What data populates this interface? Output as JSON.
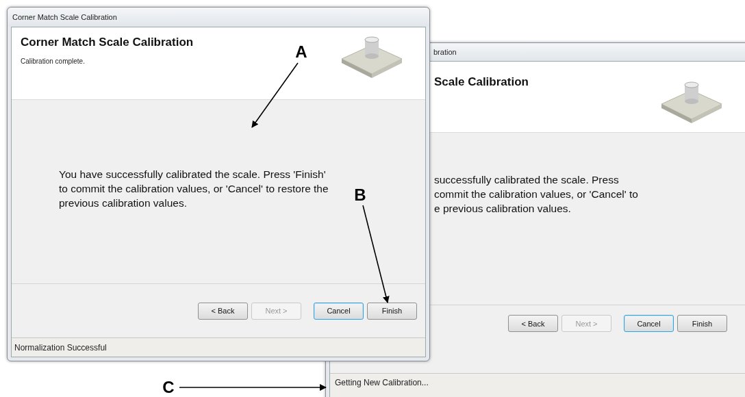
{
  "windows": [
    {
      "title": "Corner Match Scale Calibration",
      "heading": "Corner Match Scale Calibration",
      "subtitle": "Calibration complete.",
      "message": "You have successfully calibrated the scale. Press 'Finish' to commit the calibration values, or 'Cancel' to restore the previous calibration values.",
      "buttons": [
        {
          "label": "< Back",
          "disabled": false,
          "focused": false
        },
        {
          "label": "Next >",
          "disabled": true,
          "focused": false
        },
        {
          "label": "Cancel",
          "disabled": false,
          "focused": true
        },
        {
          "label": "Finish",
          "disabled": false,
          "focused": false
        }
      ],
      "status": "Normalization Successful"
    },
    {
      "title": "bration",
      "heading": "Scale Calibration",
      "message_lines": [
        "successfully calibrated the scale. Press",
        "commit the calibration values, or 'Cancel' to",
        "e previous calibration values."
      ],
      "buttons": [
        {
          "label": "< Back",
          "disabled": false,
          "focused": false
        },
        {
          "label": "Next >",
          "disabled": true,
          "focused": false
        },
        {
          "label": "Cancel",
          "disabled": false,
          "focused": true
        },
        {
          "label": "Finish",
          "disabled": false,
          "focused": false
        }
      ],
      "status": "Getting New Calibration..."
    }
  ],
  "callouts": [
    {
      "label": "A"
    },
    {
      "label": "B"
    },
    {
      "label": "C"
    }
  ]
}
